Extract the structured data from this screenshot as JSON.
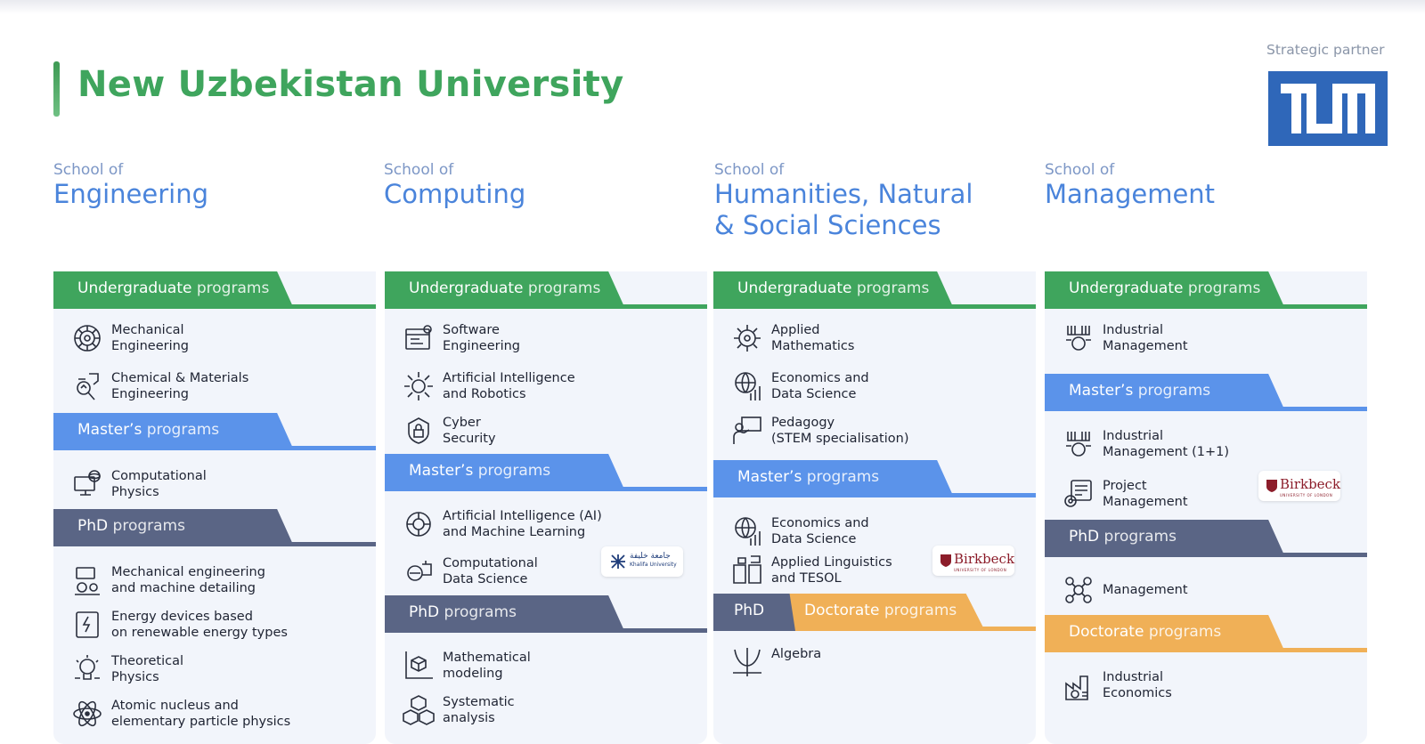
{
  "university": "New Uzbekistan University",
  "strategic_partner_label": "Strategic partner",
  "colors": {
    "green": "#3fa55d",
    "blue": "#5b93ea",
    "slate": "#5a6585",
    "orange": "#f0b057",
    "title": "#3fa55d",
    "tum": "#2f67b9"
  },
  "schools": [
    {
      "of": "School of",
      "name": "Engineering"
    },
    {
      "of": "School of",
      "name": "Computing"
    },
    {
      "of": "School of",
      "name": "Humanities, Natural\n& Social Sciences"
    },
    {
      "of": "School of",
      "name": "Management"
    }
  ],
  "labels": {
    "ug_a": "Undergraduate",
    "ug_b": "programs",
    "ms_a": "Master’s",
    "ms_b": "programs",
    "phd_a": "PhD",
    "phd_b": "programs",
    "doc_a": "Doctorate",
    "doc_b": "programs",
    "phd_only": "PhD"
  },
  "engineering": {
    "ug": [
      "Mechanical\nEngineering",
      "Chemical & Materials\nEngineering"
    ],
    "ms": [
      "Computational\nPhysics"
    ],
    "phd": [
      "Mechanical engineering\nand machine detailing",
      "Energy devices based\non renewable energy types",
      "Theoretical\nPhysics",
      "Atomic nucleus and\nelementary particle physics"
    ]
  },
  "computing": {
    "ug": [
      "Software\nEngineering",
      "Artificial Intelligence\nand Robotics",
      "Cyber\nSecurity"
    ],
    "ms": [
      "Artificial Intelligence (AI)\nand Machine Learning",
      "Computational\nData Science"
    ],
    "phd": [
      "Mathematical\nmodeling",
      "Systematic\nanalysis"
    ]
  },
  "humanities": {
    "ug": [
      "Applied\nMathematics",
      "Economics and\nData Science",
      "Pedagogy\n(STEM specialisation)"
    ],
    "ms": [
      "Economics and\nData Science",
      "Applied Linguistics\nand TESOL"
    ],
    "doc": [
      "Algebra"
    ]
  },
  "management": {
    "ug": [
      "Industrial\nManagement"
    ],
    "ms": [
      "Industrial\nManagement (1+1)",
      "Project\nManagement"
    ],
    "phd": [
      "Management"
    ],
    "doc": [
      "Industrial\nEconomics"
    ]
  },
  "partner_logos": {
    "birkbeck": "Birkbeck",
    "birkbeck_sub": "UNIVERSITY OF LONDON",
    "khalifa_ar": "جامعة خليفة",
    "khalifa_en": "Khalifa University"
  }
}
